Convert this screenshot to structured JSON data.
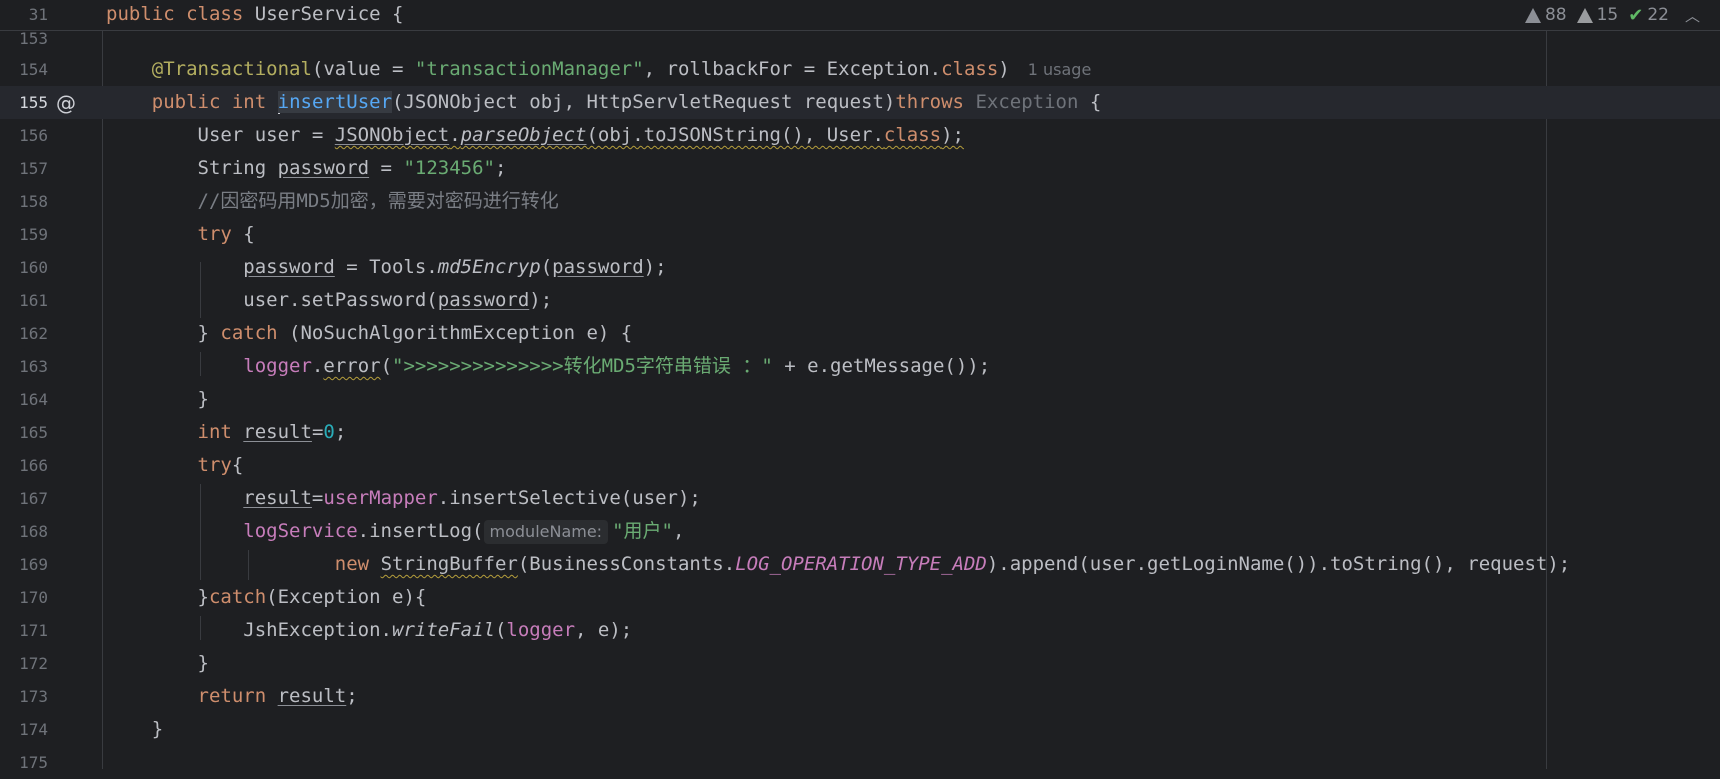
{
  "sticky": {
    "line_number": "31",
    "text_kw1": "public",
    "text_kw2": "class",
    "text_name": "UserService",
    "text_brace": "{"
  },
  "inspections": {
    "errors": "88",
    "warnings": "15",
    "ok": "22"
  },
  "lines": {
    "l153": "153",
    "l154": "154",
    "l155": "155",
    "l156": "156",
    "l157": "157",
    "l158": "158",
    "l159": "159",
    "l160": "160",
    "l161": "161",
    "l162": "162",
    "l163": "163",
    "l164": "164",
    "l165": "165",
    "l166": "166",
    "l167": "167",
    "l168": "168",
    "l169": "169",
    "l170": "170",
    "l171": "171",
    "l172": "172",
    "l173": "173",
    "l174": "174",
    "l175": "175"
  },
  "code": {
    "c154": {
      "ann": "@Transactional",
      "p1": "(value = ",
      "s1": "\"transactionManager\"",
      "p2": ", rollbackFor = Exception.",
      "kw": "class",
      "p3": ")",
      "usage": "1 usage"
    },
    "c155": {
      "kw1": "public",
      "kw2": "int",
      "fn": "insertUser",
      "p1": "(JSONObject obj, HttpServletRequest request)",
      "kw3": "throws",
      "gray": "Exception",
      "p2": " {"
    },
    "c156": {
      "p1": "User user = ",
      "cls": "JSONObject",
      "dot": ".",
      "m": "parseObject",
      "p2": "(obj.toJSONString(), User.",
      "kw": "class",
      "p3": ");"
    },
    "c157": {
      "p1": "String ",
      "var": "password",
      "p2": " = ",
      "s": "\"123456\"",
      "p3": ";"
    },
    "c158": {
      "cmt": "//因密码用MD5加密，需要对密码进行转化"
    },
    "c159": {
      "kw": "try",
      "p": " {"
    },
    "c160": {
      "var": "password",
      "p1": " = Tools.",
      "m": "md5Encryp",
      "p2": "(",
      "var2": "password",
      "p3": ");"
    },
    "c161": {
      "p1": "user.setPassword(",
      "var": "password",
      "p2": ");"
    },
    "c162": {
      "p1": "} ",
      "kw": "catch",
      "p2": " (NoSuchAlgorithmException e) {"
    },
    "c163": {
      "fld": "logger",
      "p1": ".",
      "m": "error",
      "p2": "(",
      "s": "\">>>>>>>>>>>>>>转化MD5字符串错误 ：\"",
      "p3": " + e.getMessage());"
    },
    "c164": {
      "p": "}"
    },
    "c165": {
      "kw": "int",
      "sp": " ",
      "var": "result",
      "p1": "=",
      "num": "0",
      "p2": ";"
    },
    "c166": {
      "kw": "try",
      "p": "{"
    },
    "c167": {
      "var": "result",
      "p1": "=",
      "fld": "userMapper",
      "p2": ".insertSelective(user);"
    },
    "c168": {
      "fld": "logService",
      "p1": ".insertLog(",
      "hint": "moduleName:",
      "s": "\"用户\"",
      "p2": ","
    },
    "c169": {
      "kw": "new",
      "sp": " ",
      "cls": "StringBuffer",
      "p1": "(BusinessConstants.",
      "cst": "LOG_OPERATION_TYPE_ADD",
      "p2": ").append(user.getLoginName()).toString(), request);"
    },
    "c170": {
      "p1": "}",
      "kw": "catch",
      "p2": "(Exception e){"
    },
    "c171": {
      "p1": "JshException.",
      "m": "writeFail",
      "p2": "(",
      "fld": "logger",
      "p3": ", e);"
    },
    "c172": {
      "p": "}"
    },
    "c173": {
      "kw": "return",
      "sp": " ",
      "var": "result",
      "p": ";"
    },
    "c174": {
      "p": "}"
    }
  },
  "colors": {
    "background": "#1e1f22",
    "keyword": "#cf8e6d",
    "string": "#6aab73",
    "annotation": "#b3ae60",
    "function": "#56a8f5",
    "field": "#c77dbb",
    "number": "#2aacb8"
  }
}
